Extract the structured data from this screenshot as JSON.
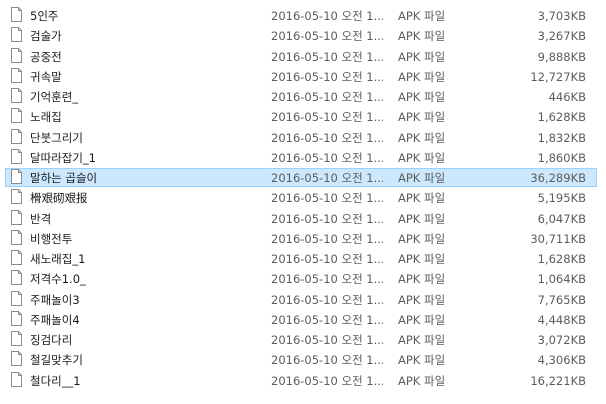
{
  "files": [
    {
      "name": "5인주",
      "date": "2016-05-10 오전 1...",
      "type": "APK 파일",
      "size": "3,703KB"
    },
    {
      "name": "검술가",
      "date": "2016-05-10 오전 1...",
      "type": "APK 파일",
      "size": "3,267KB"
    },
    {
      "name": "공중전",
      "date": "2016-05-10 오전 1...",
      "type": "APK 파일",
      "size": "9,888KB"
    },
    {
      "name": "귀속말",
      "date": "2016-05-10 오전 1...",
      "type": "APK 파일",
      "size": "12,727KB"
    },
    {
      "name": "기억훈련_",
      "date": "2016-05-10 오전 1...",
      "type": "APK 파일",
      "size": "446KB"
    },
    {
      "name": "노래집",
      "date": "2016-05-10 오전 1...",
      "type": "APK 파일",
      "size": "1,628KB"
    },
    {
      "name": "단붓그리기",
      "date": "2016-05-10 오전 1...",
      "type": "APK 파일",
      "size": "1,832KB"
    },
    {
      "name": "달따라잡기_1",
      "date": "2016-05-10 오전 1...",
      "type": "APK 파일",
      "size": "1,860KB"
    },
    {
      "name": "말하는 곱슬이",
      "date": "2016-05-10 오전 1...",
      "type": "APK 파일",
      "size": "36,289KB"
    },
    {
      "name": "榾艰砌艰报",
      "date": "2016-05-10 오전 1...",
      "type": "APK 파일",
      "size": "5,195KB"
    },
    {
      "name": "반격",
      "date": "2016-05-10 오전 1...",
      "type": "APK 파일",
      "size": "6,047KB"
    },
    {
      "name": "비행전투",
      "date": "2016-05-10 오전 1...",
      "type": "APK 파일",
      "size": "30,711KB"
    },
    {
      "name": "새노래집_1",
      "date": "2016-05-10 오전 1...",
      "type": "APK 파일",
      "size": "1,628KB"
    },
    {
      "name": "저격수1.0_",
      "date": "2016-05-10 오전 1...",
      "type": "APK 파일",
      "size": "1,064KB"
    },
    {
      "name": "주패놀이3",
      "date": "2016-05-10 오전 1...",
      "type": "APK 파일",
      "size": "7,765KB"
    },
    {
      "name": "주패놀이4",
      "date": "2016-05-10 오전 1...",
      "type": "APK 파일",
      "size": "4,448KB"
    },
    {
      "name": "징검다리",
      "date": "2016-05-10 오전 1...",
      "type": "APK 파일",
      "size": "3,072KB"
    },
    {
      "name": "철길맞추기",
      "date": "2016-05-10 오전 1...",
      "type": "APK 파일",
      "size": "4,306KB"
    },
    {
      "name": "철다리__1",
      "date": "2016-05-10 오전 1...",
      "type": "APK 파일",
      "size": "16,221KB"
    }
  ],
  "selected_index": 8,
  "colors": {
    "selection_bg": "#cce8ff",
    "selection_border": "#99d1ff",
    "secondary_text": "#5c5c5c"
  },
  "icon": "file-icon"
}
